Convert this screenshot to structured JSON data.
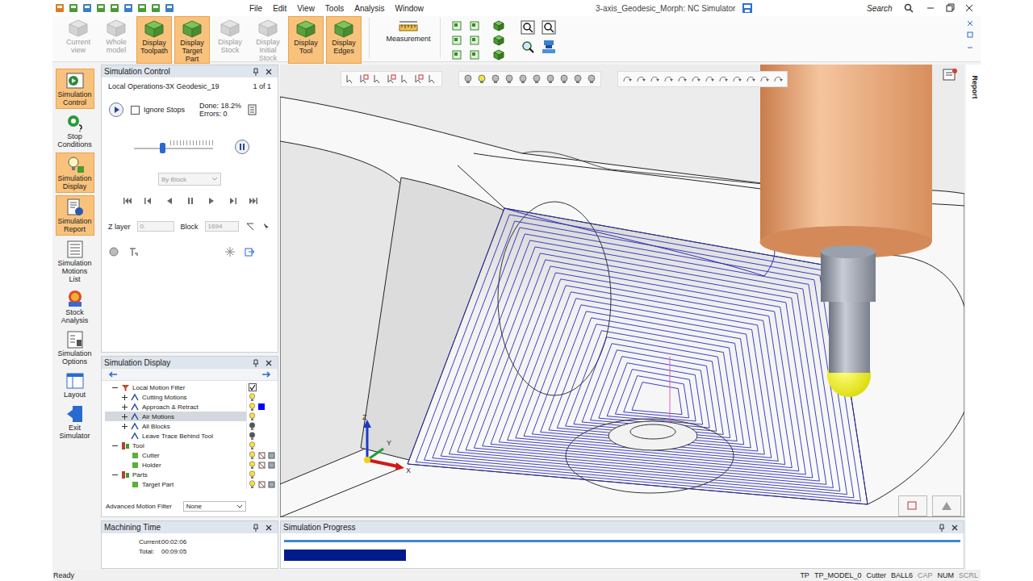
{
  "window": {
    "title": "3-axis_Geodesic_Morph: NC Simulator"
  },
  "menu": [
    "File",
    "Edit",
    "View",
    "Tools",
    "Analysis",
    "Window"
  ],
  "search": {
    "placeholder": "Search"
  },
  "ribbon": {
    "buttons": [
      {
        "label": "Current view",
        "selected": false,
        "disabled": true
      },
      {
        "label": "Whole model",
        "selected": false,
        "disabled": true
      },
      {
        "label": "Display Toolpath",
        "selected": true,
        "disabled": false
      },
      {
        "label": "Display Target Part",
        "selected": true,
        "disabled": false
      },
      {
        "label": "Display Stock",
        "selected": false,
        "disabled": true
      },
      {
        "label": "Display Initial Stock",
        "selected": false,
        "disabled": true
      },
      {
        "label": "Display Tool",
        "selected": true,
        "disabled": false
      },
      {
        "label": "Display Edges",
        "selected": true,
        "disabled": false
      }
    ],
    "measurement": "Measurement"
  },
  "sidebar": [
    {
      "label": "Simulation Control",
      "selected": true
    },
    {
      "label": "Stop Conditions",
      "selected": false
    },
    {
      "label": "Simulation Display",
      "selected": true
    },
    {
      "label": "Simulation Report",
      "selected": true
    },
    {
      "label": "Simulation Motions List",
      "selected": false
    },
    {
      "label": "Stock Analysis",
      "selected": false
    },
    {
      "label": "Simulation Options",
      "selected": false
    },
    {
      "label": "Layout",
      "selected": false
    },
    {
      "label": "Exit Simulator",
      "selected": false
    }
  ],
  "simulation_control": {
    "title": "Simulation Control",
    "operation": "Local Operations-3X Geodesic_19",
    "count": "1 of 1",
    "ignore_stops": {
      "label": "Ignore Stops",
      "checked": false
    },
    "done_label": "Done:",
    "done": "18.2%",
    "errors_label": "Errors:",
    "errors": "0",
    "speed": {
      "level": 0.36
    },
    "mode": {
      "value": "By Block",
      "disabled": true
    },
    "z_layer": {
      "label": "Z layer",
      "value": "0.",
      "disabled": true
    },
    "block": {
      "label": "Block",
      "value": "1694",
      "disabled": true
    }
  },
  "simulation_display": {
    "title": "Simulation Display",
    "tree": [
      {
        "label": "Local Motion Filter",
        "depth": 0,
        "expander": "expanded",
        "kind": "filter",
        "checked": true,
        "visible": true,
        "selected": false
      },
      {
        "label": "Cutting Motions",
        "depth": 1,
        "expander": "collapsed",
        "kind": "motion",
        "checked": false,
        "visible": true,
        "selected": false
      },
      {
        "label": "Approach & Retract",
        "depth": 1,
        "expander": "collapsed",
        "kind": "motion",
        "checked": false,
        "visible": true,
        "selected": false,
        "color": "#0000ff"
      },
      {
        "label": "Air Motions",
        "depth": 1,
        "expander": "collapsed",
        "kind": "motion",
        "checked": false,
        "visible": true,
        "selected": true
      },
      {
        "label": "All Blocks",
        "depth": 1,
        "expander": "collapsed",
        "kind": "motion",
        "checked": false,
        "visible": false,
        "selected": false
      },
      {
        "label": "Leave Trace Behind Tool",
        "depth": 1,
        "expander": "none",
        "kind": "motion",
        "checked": false,
        "visible": false,
        "selected": false
      },
      {
        "label": "Tool",
        "depth": 0,
        "expander": "expanded",
        "kind": "group",
        "checked": false,
        "visible": true,
        "selected": false
      },
      {
        "label": "Cutter",
        "depth": 1,
        "expander": "none",
        "kind": "part",
        "checked": false,
        "visible": true,
        "selected": false
      },
      {
        "label": "Holder",
        "depth": 1,
        "expander": "none",
        "kind": "part",
        "checked": false,
        "visible": true,
        "selected": false
      },
      {
        "label": "Parts",
        "depth": 0,
        "expander": "expanded",
        "kind": "group",
        "checked": false,
        "visible": true,
        "selected": false
      },
      {
        "label": "Target Part",
        "depth": 1,
        "expander": "none",
        "kind": "part",
        "checked": false,
        "visible": true,
        "selected": false
      }
    ],
    "advanced_filter": {
      "label": "Advanced Motion Filter",
      "value": "None"
    }
  },
  "machining_time": {
    "title": "Machining Time",
    "rows": [
      {
        "label": "Current:",
        "value": "00:02:06"
      },
      {
        "label": "Total:",
        "value": "00:09:05"
      }
    ]
  },
  "viewport": {
    "axes": [
      "Z",
      "Y",
      "X"
    ]
  },
  "report_tab": "Report",
  "progress": {
    "title": "Simulation Progress",
    "bars": [
      {
        "level": 1
      },
      {
        "level": 0.18
      }
    ]
  },
  "status_bar": {
    "message": "Ready",
    "items": [
      {
        "label": "TP",
        "disabled": false
      },
      {
        "label": "TP_MODEL_0",
        "disabled": false
      },
      {
        "label": "Cutter",
        "disabled": false
      },
      {
        "label": "BALL6",
        "disabled": false
      },
      {
        "label": "CAP",
        "disabled": true
      },
      {
        "label": "NUM",
        "disabled": false
      },
      {
        "label": "SCRL",
        "disabled": true
      }
    ]
  }
}
